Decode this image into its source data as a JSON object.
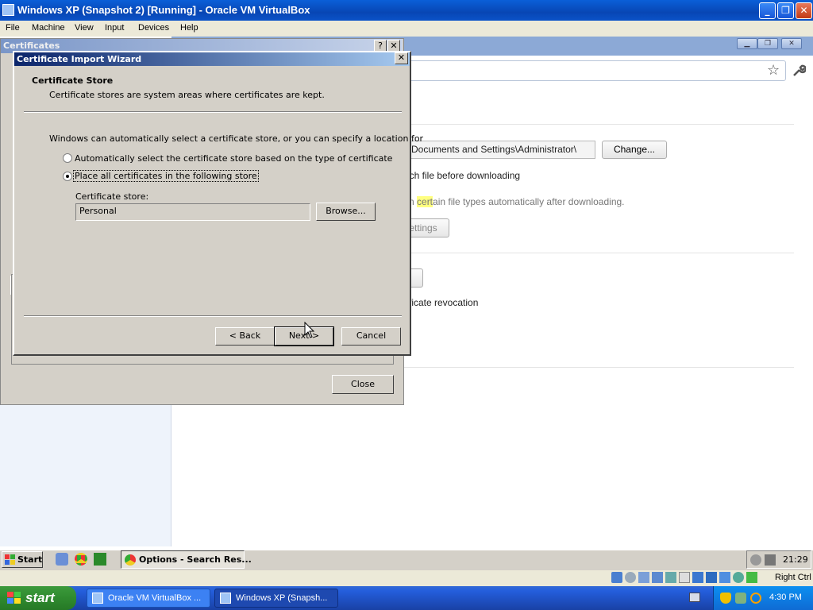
{
  "host": {
    "title": "Windows XP (Snapshot 2) [Running] - Oracle VM VirtualBox",
    "menu": [
      "File",
      "Machine",
      "View",
      "Input",
      "Devices",
      "Help"
    ],
    "status_right": "Right Ctrl"
  },
  "browser_page": {
    "download_path": "Documents and Settings\\Administrator\\",
    "change_label": "Change...",
    "ask_text": "ach file before downloading",
    "auto_open_prefix": "n ",
    "auto_open_highlight": "cert",
    "auto_open_suffix": "ain file types automatically after downloading.",
    "settings_label": "ettings",
    "revocation_text": "ficate revocation",
    "highlight_color": "#ffff80"
  },
  "certificates_dialog": {
    "title": "Certificates",
    "help_label": "?",
    "close_x": "✕",
    "close_label": "Close"
  },
  "wizard": {
    "title": "Certificate Import Wizard",
    "heading": "Certificate Store",
    "subheading": "Certificate stores are system areas where certificates are kept.",
    "intro": "Windows can automatically select a certificate store, or you can specify a location for",
    "option_auto": "Automatically select the certificate store based on the type of certificate",
    "option_manual": "Place all certificates in the following store",
    "selected_option": "manual",
    "store_label": "Certificate store:",
    "store_value": "Personal",
    "browse_label": "Browse...",
    "back_label": "< Back",
    "next_label": "Next >",
    "cancel_label": "Cancel",
    "close_x": "✕"
  },
  "guest_taskbar": {
    "start_label": "Start",
    "active_task": "Options - Search Res...",
    "clock": "21:29"
  },
  "xp_taskbar": {
    "start_label": "start",
    "tasks": [
      "Oracle VM VirtualBox ...",
      "Windows XP (Snapsh..."
    ],
    "clock": "4:30 PM"
  }
}
